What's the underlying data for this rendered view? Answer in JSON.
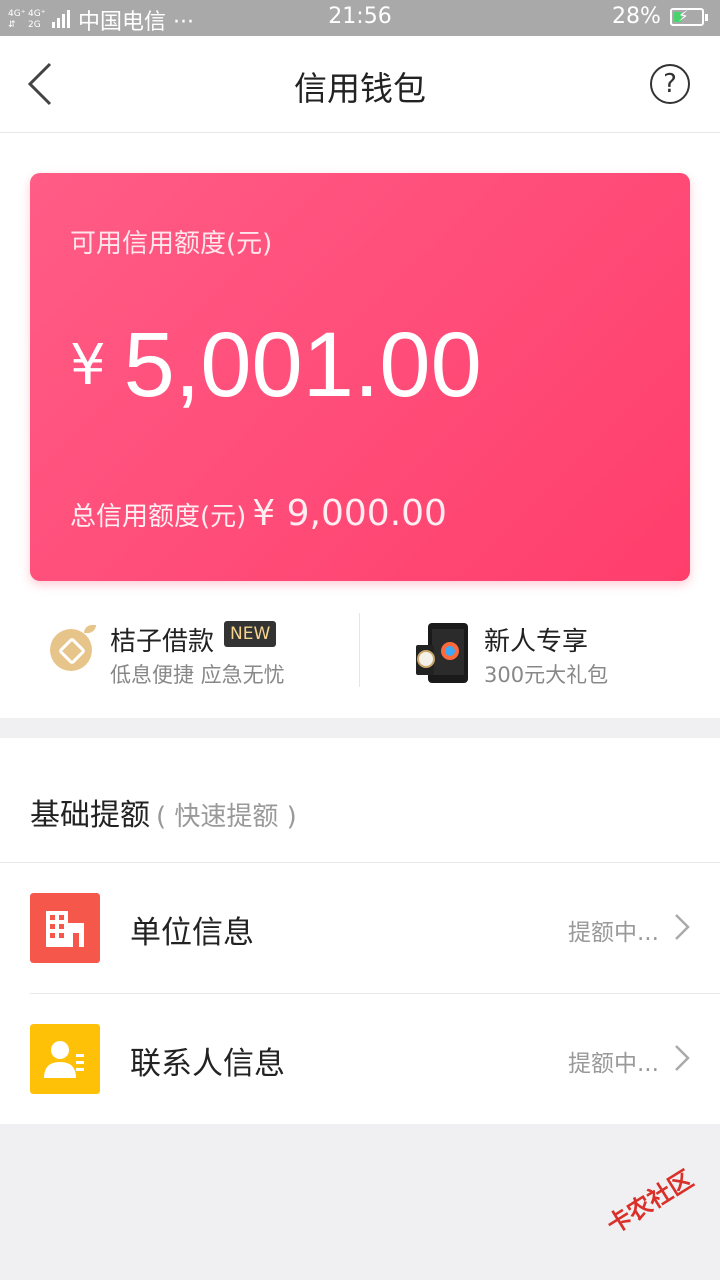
{
  "status_bar": {
    "network": "4G 4G 2G",
    "carrier": "中国电信 ···",
    "time": "21:56",
    "battery": "28%",
    "battery_level": 0.28
  },
  "header": {
    "title": "信用钱包",
    "help": "?"
  },
  "credit_card": {
    "available_label": "可用信用额度(元)",
    "currency": "¥",
    "available_amount": "5,001.00",
    "total_label": "总信用额度(元)",
    "total_amount": "¥ 9,000.00",
    "gradient_start": "#ff5c86",
    "gradient_end": "#ff3e6c"
  },
  "promos": [
    {
      "title": "桔子借款",
      "badge": "NEW",
      "subtitle": "低息便捷   应急无忧",
      "icon": "orange-coin-icon"
    },
    {
      "title": "新人专享",
      "subtitle": "300元大礼包",
      "icon": "phone-watch-image"
    }
  ],
  "section": {
    "title": "基础提额",
    "subtitle": "( 快速提额 )",
    "items": [
      {
        "label": "单位信息",
        "status": "提额中...",
        "icon": "building-icon",
        "color": "#f5584a"
      },
      {
        "label": "联系人信息",
        "status": "提额中...",
        "icon": "contact-person-icon",
        "color": "#ffc107"
      }
    ]
  },
  "watermark": "卡农社区"
}
